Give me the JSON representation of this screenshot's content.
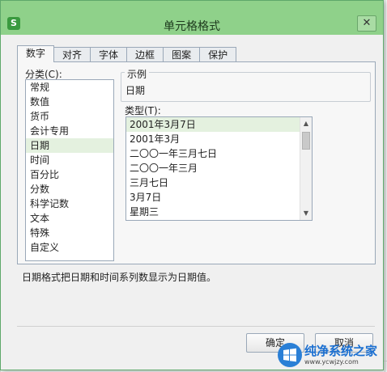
{
  "window": {
    "title": "单元格格式",
    "app_icon": "S",
    "close_glyph": "✕"
  },
  "tabs": [
    {
      "label": "数字",
      "active": true
    },
    {
      "label": "对齐"
    },
    {
      "label": "字体"
    },
    {
      "label": "边框"
    },
    {
      "label": "图案"
    },
    {
      "label": "保护"
    }
  ],
  "category": {
    "label": "分类(C):",
    "items": [
      "常规",
      "数值",
      "货币",
      "会计专用",
      "日期",
      "时间",
      "百分比",
      "分数",
      "科学记数",
      "文本",
      "特殊",
      "自定义"
    ],
    "selected": "日期"
  },
  "sample": {
    "label": "示例",
    "value": "日期"
  },
  "type": {
    "label": "类型(T):",
    "items": [
      "2001年3月7日",
      "2001年3月",
      "二〇〇一年三月七日",
      "二〇〇一年三月",
      "三月七日",
      "3月7日",
      "星期三"
    ],
    "selected": "2001年3月7日"
  },
  "description": "日期格式把日期和时间系列数显示为日期值。",
  "buttons": {
    "ok": "确定",
    "cancel": "取消"
  },
  "watermark": {
    "title": "纯净系统之家",
    "url": "www.ycwjzy.com"
  },
  "colors": {
    "titlebar": "#8fd18a",
    "selection": "#e4f1df",
    "watermark_blue": "#1a6fd1"
  }
}
